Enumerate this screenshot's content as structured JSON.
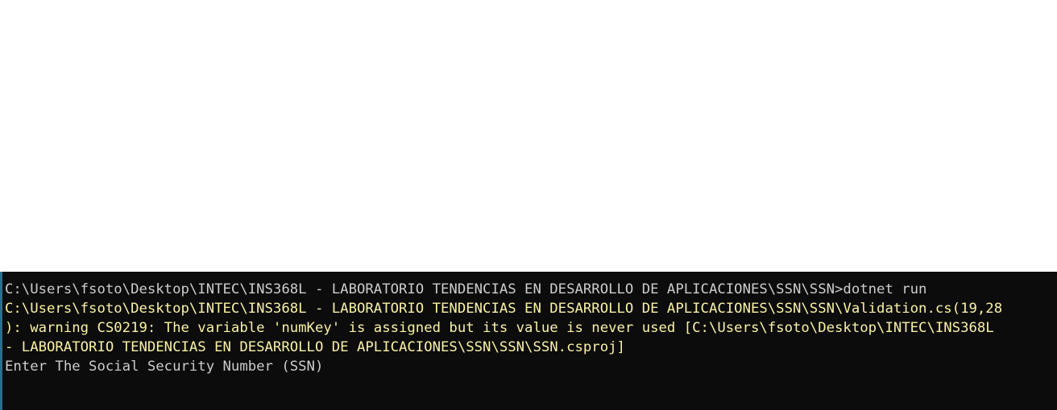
{
  "console": {
    "lines": [
      {
        "text": "C:\\Users\\fsoto\\Desktop\\INTEC\\INS368L - LABORATORIO TENDENCIAS EN DESARROLLO DE APLICACIONES\\SSN\\SSN>dotnet run",
        "style": "normal"
      },
      {
        "text": "C:\\Users\\fsoto\\Desktop\\INTEC\\INS368L - LABORATORIO TENDENCIAS EN DESARROLLO DE APLICACIONES\\SSN\\SSN\\Validation.cs(19,28",
        "style": "warning"
      },
      {
        "text": "): warning CS0219: The variable 'numKey' is assigned but its value is never used [C:\\Users\\fsoto\\Desktop\\INTEC\\INS368L",
        "style": "warning"
      },
      {
        "text": "- LABORATORIO TENDENCIAS EN DESARROLLO DE APLICACIONES\\SSN\\SSN\\SSN.csproj]",
        "style": "warning"
      },
      {
        "text": "Enter The Social Security Number (SSN)",
        "style": "normal"
      }
    ],
    "colors": {
      "background": "#0c0c0c",
      "text": "#cccccc",
      "warning": "#f9f1a5"
    }
  }
}
